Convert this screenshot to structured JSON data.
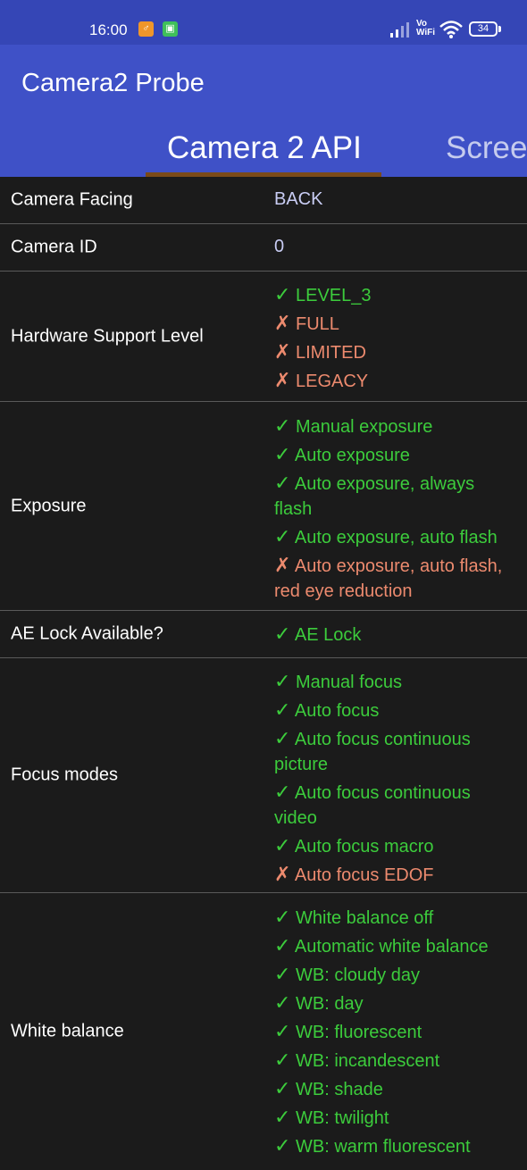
{
  "status_bar": {
    "time": "16:00",
    "badge1_icon": "app-notification-icon",
    "badge2_icon": "store-notification-icon",
    "volte": "Vo",
    "wifi_text": "WiFi",
    "battery": "34"
  },
  "app": {
    "title": "Camera2 Probe"
  },
  "tabs": [
    {
      "label": "Camera 2 API",
      "active": true
    },
    {
      "label": "Scree",
      "active": false
    }
  ],
  "colors": {
    "supported": "#3ccc3c",
    "unsupported": "#ec8a6e",
    "accent": "#3f51c7"
  },
  "rows": {
    "facing": {
      "label": "Camera Facing",
      "value": "BACK"
    },
    "camera_id": {
      "label": "Camera ID",
      "value": "0"
    },
    "hardware": {
      "label": "Hardware Support Level",
      "items": [
        {
          "mark": "✓",
          "text": "LEVEL_3"
        },
        {
          "mark": "✗",
          "text": "FULL"
        },
        {
          "mark": "✗",
          "text": "LIMITED"
        },
        {
          "mark": "✗",
          "text": "LEGACY"
        }
      ]
    },
    "exposure": {
      "label": "Exposure",
      "items": [
        {
          "mark": "✓",
          "text": "Manual exposure"
        },
        {
          "mark": "✓",
          "text": "Auto exposure"
        },
        {
          "mark": "✓",
          "text": "Auto exposure, always flash"
        },
        {
          "mark": "✓",
          "text": "Auto exposure, auto flash"
        },
        {
          "mark": "✗",
          "text": "Auto exposure, auto flash, red eye reduction"
        }
      ]
    },
    "ae_lock": {
      "label": "AE Lock Available?",
      "items": [
        {
          "mark": "✓",
          "text": "AE Lock"
        }
      ]
    },
    "focus": {
      "label": "Focus modes",
      "items": [
        {
          "mark": "✓",
          "text": "Manual focus"
        },
        {
          "mark": "✓",
          "text": "Auto focus"
        },
        {
          "mark": "✓",
          "text": "Auto focus continuous picture"
        },
        {
          "mark": "✓",
          "text": "Auto focus continuous video"
        },
        {
          "mark": "✓",
          "text": "Auto focus macro"
        },
        {
          "mark": "✗",
          "text": "Auto focus EDOF"
        }
      ]
    },
    "white_balance": {
      "label": "White balance",
      "items": [
        {
          "mark": "✓",
          "text": "White balance off"
        },
        {
          "mark": "✓",
          "text": "Automatic white balance"
        },
        {
          "mark": "✓",
          "text": "WB: cloudy day"
        },
        {
          "mark": "✓",
          "text": "WB: day"
        },
        {
          "mark": "✓",
          "text": "WB: fluorescent"
        },
        {
          "mark": "✓",
          "text": "WB: incandescent"
        },
        {
          "mark": "✓",
          "text": "WB: shade"
        },
        {
          "mark": "✓",
          "text": "WB: twilight"
        },
        {
          "mark": "✓",
          "text": "WB: warm fluorescent"
        }
      ]
    }
  }
}
